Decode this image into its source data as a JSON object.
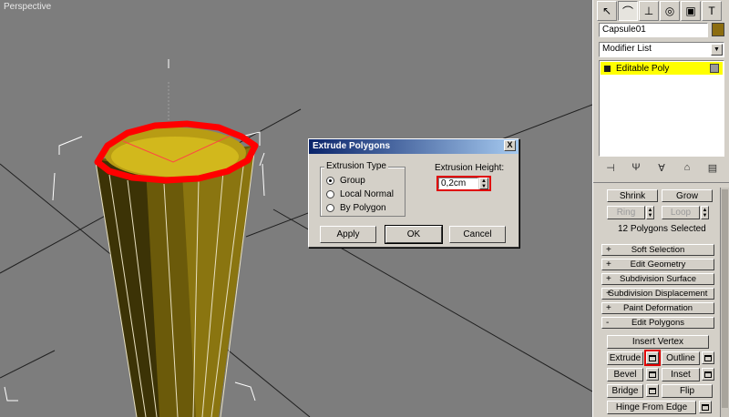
{
  "viewport": {
    "label": "Perspective"
  },
  "command_panel": {
    "tabs": [
      {
        "icon": "cursor-arrow-icon"
      },
      {
        "icon": "modify-bend-icon"
      },
      {
        "icon": "hierarchy-icon"
      },
      {
        "icon": "motion-icon"
      },
      {
        "icon": "display-icon"
      },
      {
        "icon": "utilities-hammer-icon"
      }
    ],
    "object_name": "Capsule01",
    "object_color": "#8c6d10",
    "modifier_list": "Modifier List",
    "stack_items": [
      "Editable Poly"
    ],
    "selection": {
      "shrink": "Shrink",
      "grow": "Grow",
      "ring": "Ring",
      "loop": "Loop",
      "status": "12 Polygons Selected"
    },
    "rollouts": [
      {
        "sign": "+",
        "label": "Soft Selection"
      },
      {
        "sign": "+",
        "label": "Edit Geometry"
      },
      {
        "sign": "+",
        "label": "Subdivision Surface"
      },
      {
        "sign": "+",
        "label": "Subdivision Displacement"
      },
      {
        "sign": "+",
        "label": "Paint Deformation"
      },
      {
        "sign": "-",
        "label": "Edit Polygons"
      }
    ],
    "edit_polygons": {
      "insert_vertex": "Insert Vertex",
      "extrude": "Extrude",
      "outline": "Outline",
      "bevel": "Bevel",
      "inset": "Inset",
      "bridge": "Bridge",
      "flip": "Flip",
      "hinge": "Hinge From Edge"
    }
  },
  "dialog": {
    "title": "Extrude Polygons",
    "close": "X",
    "extrusion_type_label": "Extrusion Type",
    "options": [
      "Group",
      "Local Normal",
      "By Polygon"
    ],
    "selected_option": "Group",
    "height_label": "Extrusion Height:",
    "height_value": "0,2cm",
    "apply": "Apply",
    "ok": "OK",
    "cancel": "Cancel"
  },
  "colors": {
    "selection_highlight": "#ff0000",
    "stack_highlight": "#ffff00",
    "title_bar": "#0a246a"
  }
}
